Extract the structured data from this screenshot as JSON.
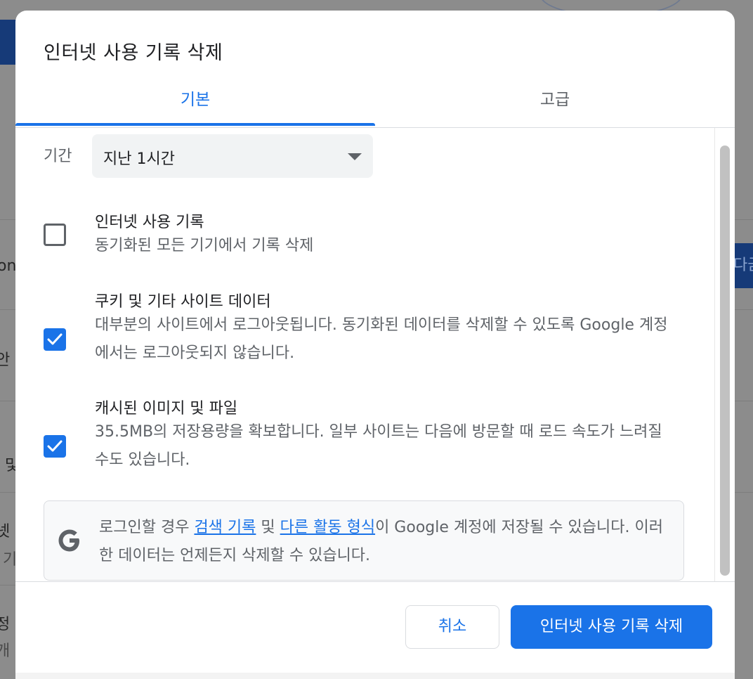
{
  "background": {
    "left_fragments": [
      "on",
      "안",
      "- 및",
      "넷",
      "· 기",
      "정",
      "개"
    ],
    "right_fragment": "다금"
  },
  "dialog": {
    "title": "인터넷 사용 기록 삭제",
    "tabs": [
      {
        "label": "기본",
        "selected": true
      },
      {
        "label": "고급",
        "selected": false
      }
    ],
    "period": {
      "label": "기간",
      "selected": "지난 1시간"
    },
    "options": [
      {
        "title": "인터넷 사용 기록",
        "description": "동기화된 모든 기기에서 기록 삭제",
        "checked": false
      },
      {
        "title": "쿠키 및 기타 사이트 데이터",
        "description": "대부분의 사이트에서 로그아웃됩니다. 동기화된 데이터를 삭제할 수 있도록 Google 계정에서는 로그아웃되지 않습니다.",
        "checked": true
      },
      {
        "title": "캐시된 이미지 및 파일",
        "description": "35.5MB의 저장용량을 확보합니다. 일부 사이트는 다음에 방문할 때 로드 속도가 느려질 수도 있습니다.",
        "checked": true
      }
    ],
    "info": {
      "icon": "google-g-icon",
      "prefix": "로그인할 경우 ",
      "link1": "검색 기록",
      "middle": " 및 ",
      "link2": "다른 활동 형식",
      "suffix": "이 Google 계정에 저장될 수 있습니다. 이러한 데이터는 언제든지 삭제할 수 있습니다."
    },
    "buttons": {
      "cancel": "취소",
      "confirm": "인터넷 사용 기록 삭제"
    }
  },
  "colors": {
    "accent": "#1a73e8",
    "text_primary": "#202124",
    "text_secondary": "#5f6368"
  }
}
